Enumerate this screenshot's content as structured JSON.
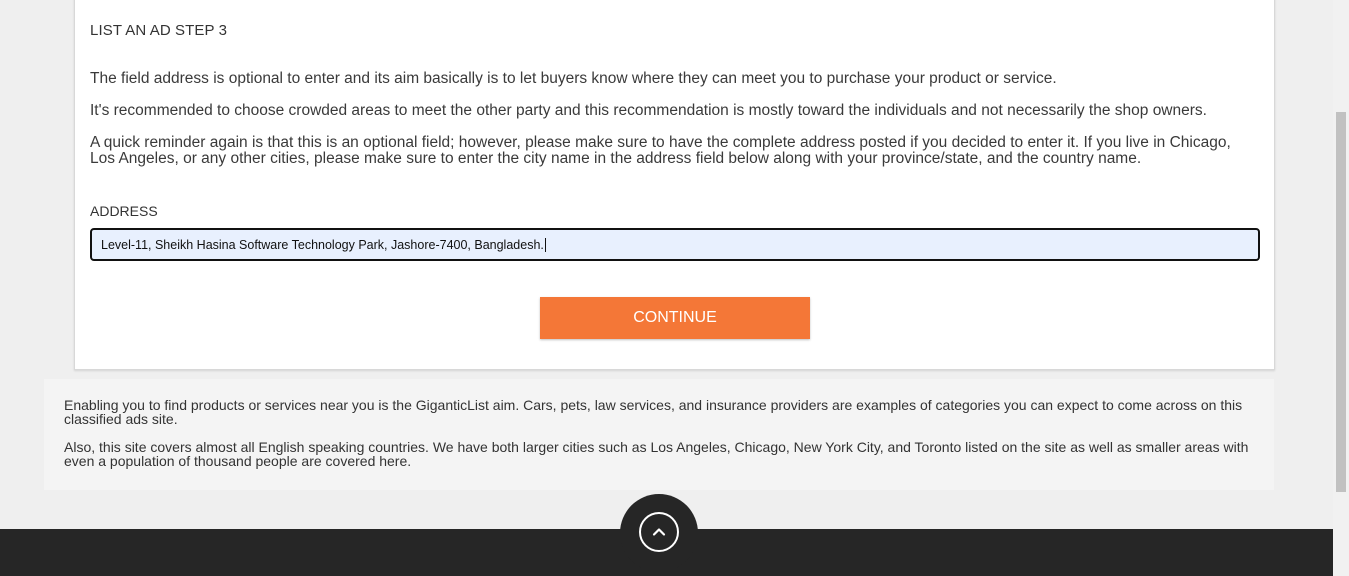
{
  "step_title": "LIST AN AD STEP 3",
  "paragraphs": [
    "The field address is optional to enter and its aim basically is to let buyers know where they can meet you to purchase your product or service.",
    "It's recommended to choose crowded areas to meet the other party and this recommendation is mostly toward the individuals and not necessarily the shop owners.",
    "A quick reminder again is that this is an optional field; however, please make sure to have the complete address posted if you decided to enter it. If you live in Chicago, Los Angeles, or any other cities, please make sure to enter the city name in the address field below along with your province/state, and the country name."
  ],
  "address": {
    "label": "ADDRESS",
    "value": "Level-11, Sheikh Hasina Software Technology Park, Jashore-7400, Bangladesh."
  },
  "continue_label": "CONTINUE",
  "info": [
    "Enabling you to find products or services near you is the GiganticList aim. Cars, pets, law services, and insurance providers are examples of categories you can expect to come across on this classified ads site.",
    "Also, this site covers almost all English speaking countries. We have both larger cities such as Los Angeles, Chicago, New York City, and Toronto listed on the site as well as smaller areas with even a population of thousand people are covered here."
  ],
  "icons": {
    "back_to_top": "chevron-up-icon"
  },
  "colors": {
    "accent": "#f47737",
    "footer": "#262626",
    "input_bg": "#e8f0fe"
  }
}
